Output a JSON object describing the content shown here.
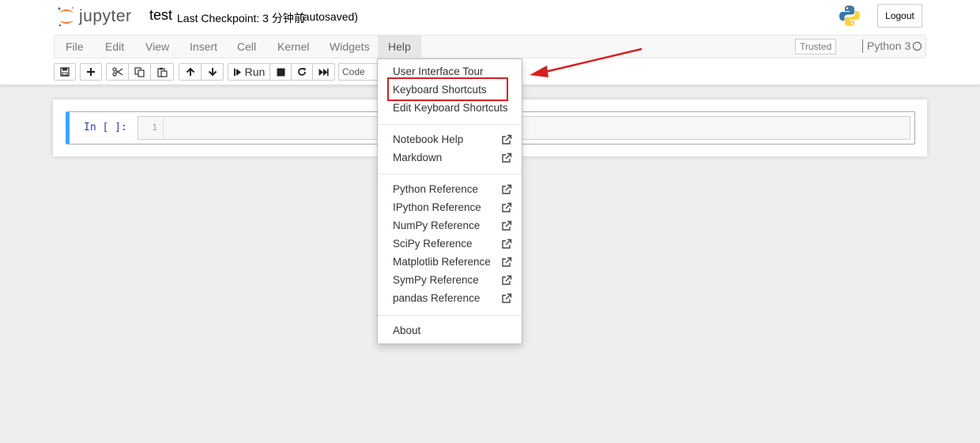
{
  "header": {
    "logo_text": "jupyter",
    "notebook_name": "test",
    "checkpoint": "Last Checkpoint: 3 分钟前",
    "autosave": "(autosaved)",
    "logout_label": "Logout"
  },
  "menubar": {
    "items": [
      "File",
      "Edit",
      "View",
      "Insert",
      "Cell",
      "Kernel",
      "Widgets",
      "Help"
    ],
    "open_menu": "Help",
    "trusted_label": "Trusted",
    "kernel_name": "Python 3"
  },
  "toolbar": {
    "run_label": "Run",
    "cell_type": "Code"
  },
  "cell": {
    "prompt": "In [ ]:",
    "line_number": "1"
  },
  "help_menu": {
    "group1": [
      "User Interface Tour",
      "Keyboard Shortcuts",
      "Edit Keyboard Shortcuts"
    ],
    "group2": [
      "Notebook Help",
      "Markdown"
    ],
    "group3": [
      "Python Reference",
      "IPython Reference",
      "NumPy Reference",
      "SciPy Reference",
      "Matplotlib Reference",
      "SymPy Reference",
      "pandas Reference"
    ],
    "group4": [
      "About"
    ],
    "highlighted_item": "Keyboard Shortcuts"
  },
  "colors": {
    "accent_blue": "#42a5f5",
    "annotation_red": "#d42020",
    "jupyter_orange": "#f37626"
  }
}
